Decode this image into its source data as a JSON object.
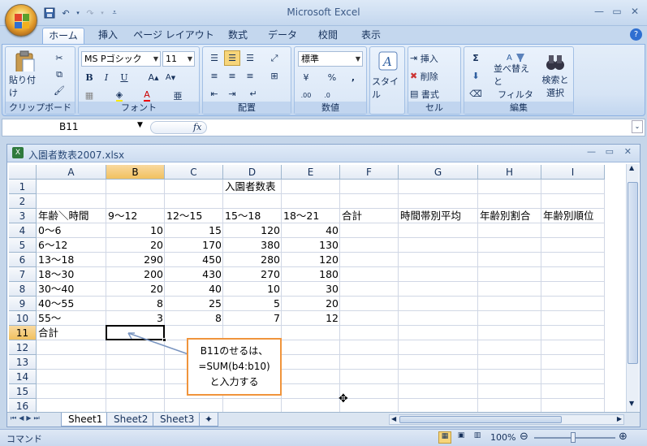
{
  "app": {
    "title": "Microsoft Excel"
  },
  "tabs": [
    "ホーム",
    "挿入",
    "ページ レイアウト",
    "数式",
    "データ",
    "校閲",
    "表示"
  ],
  "ribbon": {
    "clipboard": {
      "label": "クリップボード",
      "paste": "貼り付け"
    },
    "font": {
      "label": "フォント",
      "name": "MS Pゴシック",
      "size": "11"
    },
    "align": {
      "label": "配置"
    },
    "number": {
      "label": "数値",
      "format": "標準"
    },
    "styles": {
      "label": "スタイル"
    },
    "cells": {
      "label": "セル",
      "insert": "挿入",
      "delete": "削除",
      "format": "書式"
    },
    "edit": {
      "label": "編集",
      "sort": "並べ替えと",
      "sort2": "フィルタ",
      "find": "検索と",
      "find2": "選択"
    }
  },
  "formula": {
    "namebox": "B11",
    "fx": "fx",
    "value": ""
  },
  "workbook": {
    "title": "入園者数表2007.xlsx"
  },
  "columns": [
    "A",
    "B",
    "C",
    "D",
    "E",
    "F",
    "G",
    "H",
    "I"
  ],
  "rows": [
    "1",
    "2",
    "3",
    "4",
    "5",
    "6",
    "7",
    "8",
    "9",
    "10",
    "11",
    "12",
    "13",
    "14",
    "15",
    "16"
  ],
  "sheet": {
    "title": "入園者数表",
    "headers": [
      "年齢＼時間",
      "9～12",
      "12～15",
      "15～18",
      "18～21",
      "合計",
      "時間帯別平均",
      "年齢別割合",
      "年齢別順位"
    ],
    "data": [
      [
        "0～6",
        "10",
        "15",
        "120",
        "40"
      ],
      [
        "6～12",
        "20",
        "170",
        "380",
        "130"
      ],
      [
        "13～18",
        "290",
        "450",
        "280",
        "120"
      ],
      [
        "18～30",
        "200",
        "430",
        "270",
        "180"
      ],
      [
        "30～40",
        "20",
        "40",
        "10",
        "30"
      ],
      [
        "40～55",
        "8",
        "25",
        "5",
        "20"
      ],
      [
        "55～",
        "3",
        "8",
        "7",
        "12"
      ]
    ],
    "total_label": "合計"
  },
  "callout": {
    "line1": "B11のせるは、",
    "line2": "=SUM(b4:b10)",
    "line3": "と入力する"
  },
  "sheets": [
    "Sheet1",
    "Sheet2",
    "Sheet3"
  ],
  "status": {
    "mode": "コマンド",
    "zoom": "100%"
  },
  "colors": {
    "accent": "#f0943c",
    "selected_header": "#f1c15f"
  }
}
